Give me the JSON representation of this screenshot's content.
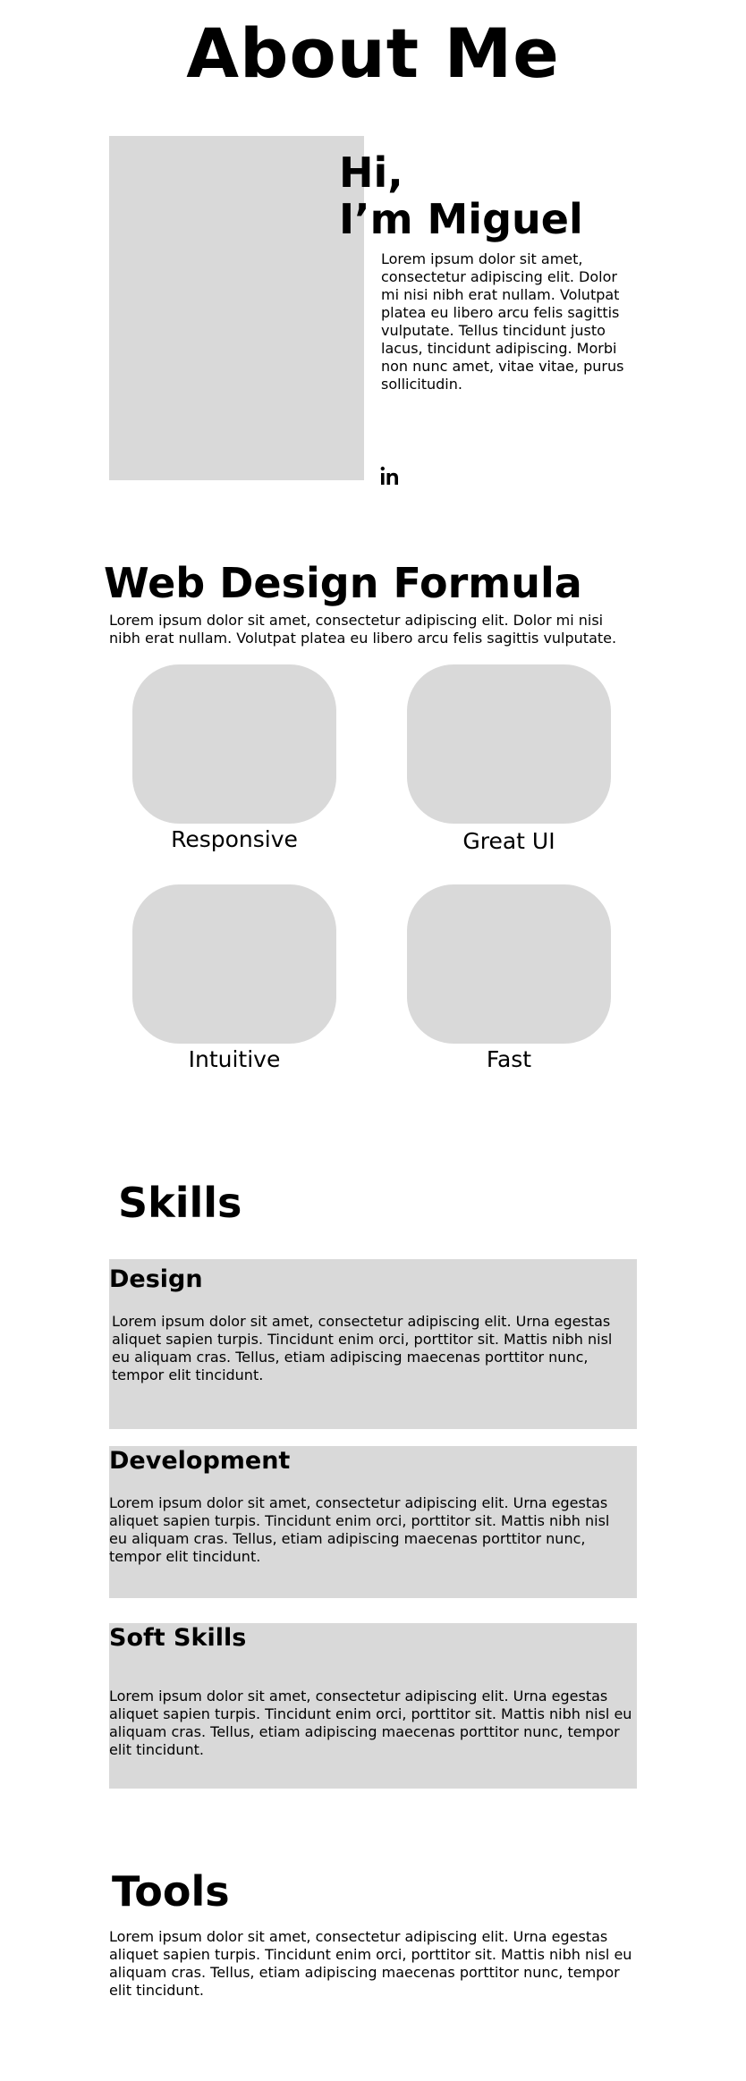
{
  "about": {
    "title": "About Me",
    "greeting_line1": "Hi,",
    "greeting_line2": "I’m Miguel",
    "intro": "Lorem ipsum dolor sit amet, consectetur adipiscing elit. Dolor mi nisi nibh erat nullam. Volutpat platea eu libero arcu felis sagittis vulputate. Tellus tincidunt justo lacus, tincidunt adipiscing. Morbi non nunc amet, vitae vitae, purus sollicitudin.",
    "social_icon": "linkedin-icon"
  },
  "formula": {
    "title": "Web Design Formula",
    "description": "Lorem ipsum dolor sit amet, consectetur adipiscing elit. Dolor mi nisi nibh erat nullam. Volutpat platea eu libero arcu felis sagittis vulputate.",
    "features": [
      {
        "label": "Responsive"
      },
      {
        "label": "Great UI"
      },
      {
        "label": "Intuitive"
      },
      {
        "label": "Fast"
      }
    ]
  },
  "skills": {
    "title": "Skills",
    "items": [
      {
        "title": "Design",
        "text": "Lorem ipsum dolor sit amet, consectetur adipiscing elit. Urna egestas aliquet sapien turpis. Tincidunt enim orci, porttitor sit. Mattis nibh nisl eu aliquam cras. Tellus, etiam adipiscing maecenas porttitor nunc, tempor elit tincidunt."
      },
      {
        "title": "Development",
        "text": "Lorem ipsum dolor sit amet, consectetur adipiscing elit. Urna egestas aliquet sapien turpis. Tincidunt enim orci, porttitor sit. Mattis nibh nisl eu aliquam cras. Tellus, etiam adipiscing maecenas porttitor nunc, tempor elit tincidunt."
      },
      {
        "title": "Soft Skills",
        "text": "Lorem ipsum dolor sit amet, consectetur adipiscing elit. Urna egestas aliquet sapien turpis. Tincidunt enim orci, porttitor sit. Mattis nibh nisl eu aliquam cras. Tellus, etiam adipiscing maecenas porttitor nunc, tempor elit tincidunt."
      }
    ]
  },
  "tools": {
    "title": "Tools",
    "text": "Lorem ipsum dolor sit amet, consectetur adipiscing elit. Urna egestas aliquet sapien turpis. Tincidunt enim orci, porttitor sit. Mattis nibh nisl eu aliquam cras. Tellus, etiam adipiscing maecenas porttitor nunc, tempor elit tincidunt."
  }
}
